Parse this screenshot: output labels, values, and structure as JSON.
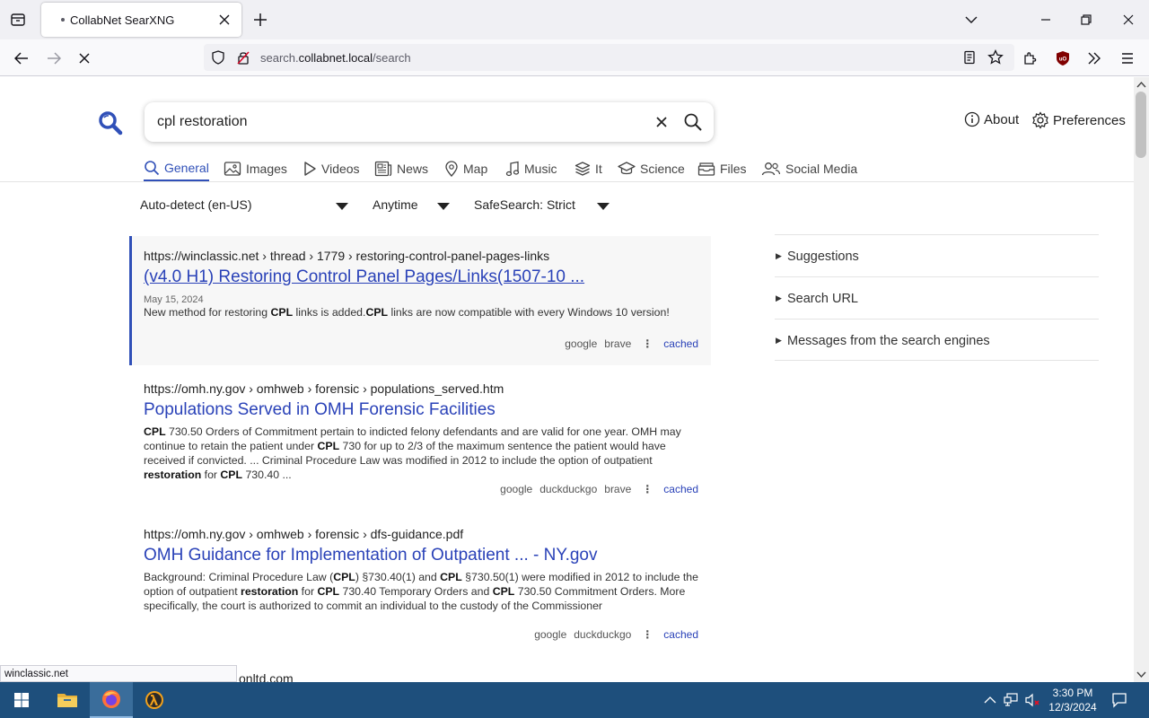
{
  "browser": {
    "tab_title": "CollabNet SearXNG",
    "url_prefix": "search.",
    "url_domain": "collabnet.local",
    "url_path": "/search"
  },
  "header": {
    "query": "cpl restoration",
    "about_label": "About",
    "preferences_label": "Preferences"
  },
  "categories": [
    {
      "label": "General",
      "icon": "search-icon",
      "active": true
    },
    {
      "label": "Images",
      "icon": "image-icon"
    },
    {
      "label": "Videos",
      "icon": "play-icon"
    },
    {
      "label": "News",
      "icon": "newspaper-icon"
    },
    {
      "label": "Map",
      "icon": "map-pin-icon"
    },
    {
      "label": "Music",
      "icon": "music-note-icon"
    },
    {
      "label": "It",
      "icon": "layers-icon"
    },
    {
      "label": "Science",
      "icon": "graduation-cap-icon"
    },
    {
      "label": "Files",
      "icon": "file-tray-icon"
    },
    {
      "label": "Social Media",
      "icon": "people-icon"
    }
  ],
  "filters": {
    "language": "Auto-detect (en-US)",
    "time": "Anytime",
    "safesearch": "SafeSearch: Strict"
  },
  "results": [
    {
      "host": "https://winclassic.net",
      "path": " › thread › 1779 › restoring-control-panel-pages-links",
      "title": "(v4.0 H1) Restoring Control Panel Pages/Links(1507-10 ...",
      "date": "May 15, 2024",
      "snippet_parts": [
        {
          "t": "New method for restoring "
        },
        {
          "t": "CPL",
          "b": true
        },
        {
          "t": " links is added."
        },
        {
          "t": "CPL",
          "b": true
        },
        {
          "t": " links are now compatible with every Windows 10 version!"
        }
      ],
      "engines": [
        "google",
        "brave"
      ],
      "cached": "cached"
    },
    {
      "host": "https://omh.ny.gov",
      "path": " › omhweb › forensic › populations_served.htm",
      "title": "Populations Served in OMH Forensic Facilities",
      "snippet_parts": [
        {
          "t": "CPL",
          "b": true
        },
        {
          "t": " 730.50 Orders of Commitment pertain to indicted felony defendants and are valid for one year. OMH may continue to retain the patient under "
        },
        {
          "t": "CPL",
          "b": true
        },
        {
          "t": " 730 for up to 2/3 of the maximum sentence the patient would have received if convicted. ... Criminal Procedure Law was modified in 2012 to include the option of outpatient "
        },
        {
          "t": "restoration",
          "b": true
        },
        {
          "t": " for "
        },
        {
          "t": "CPL",
          "b": true
        },
        {
          "t": " 730.40 ..."
        }
      ],
      "engines": [
        "google",
        "duckduckgo",
        "brave"
      ],
      "cached": "cached"
    },
    {
      "host": "https://omh.ny.gov",
      "path": " › omhweb › forensic › dfs-guidance.pdf",
      "title": "OMH Guidance for Implementation of Outpatient ... - NY.gov",
      "snippet_parts": [
        {
          "t": "Background: Criminal Procedure Law ("
        },
        {
          "t": "CPL",
          "b": true
        },
        {
          "t": ") §730.40(1) and "
        },
        {
          "t": "CPL",
          "b": true
        },
        {
          "t": " §730.50(1) were modified in 2012 to include the option of outpatient "
        },
        {
          "t": "restoration",
          "b": true
        },
        {
          "t": " for "
        },
        {
          "t": "CPL",
          "b": true
        },
        {
          "t": " 730.40 Temporary Orders and "
        },
        {
          "t": "CPL",
          "b": true
        },
        {
          "t": " 730.50 Commitment Orders. More specifically, the court is authorized to commit an individual to the custody of the Commissioner"
        }
      ],
      "engines": [
        "google",
        "duckduckgo"
      ],
      "cached": "cached"
    }
  ],
  "sidebar": {
    "suggestions": "Suggestions",
    "search_url": "Search URL",
    "engine_messages": "Messages from the search engines"
  },
  "status_url": "winclassic.net",
  "peek_url": "onltd.com",
  "taskbar": {
    "time": "3:30 PM",
    "date": "12/3/2024"
  },
  "colors": {
    "accent": "#3050b8",
    "link": "#2a42b8",
    "taskbar": "#1e4f7c"
  }
}
